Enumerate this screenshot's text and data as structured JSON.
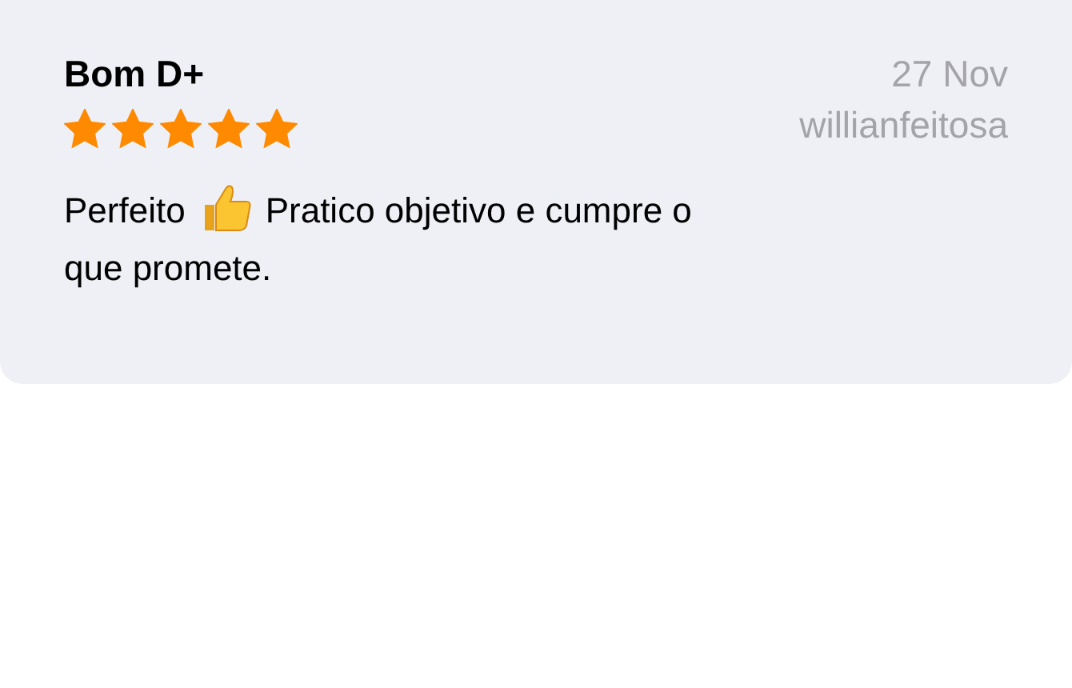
{
  "review": {
    "title": "Bom D+",
    "date": "27 Nov",
    "author": "willianfeitosa",
    "stars": 5,
    "body_before": "Perfeito",
    "body_after": "Pratico objetivo e cumpre o",
    "body_line_2": "que promete."
  }
}
